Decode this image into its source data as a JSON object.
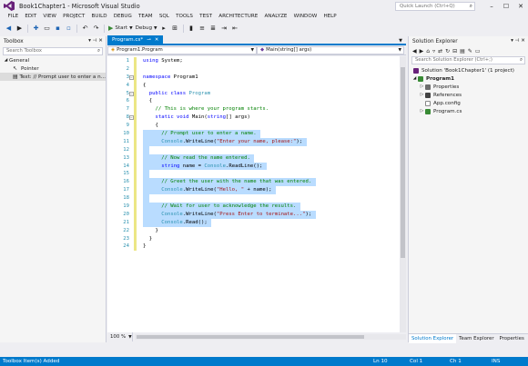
{
  "window": {
    "title": "Book1Chapter1 - Microsoft Visual Studio",
    "quick_launch_placeholder": "Quick Launch (Ctrl+Q)"
  },
  "menu": [
    "FILE",
    "EDIT",
    "VIEW",
    "PROJECT",
    "BUILD",
    "DEBUG",
    "TEAM",
    "SQL",
    "TOOLS",
    "TEST",
    "ARCHITECTURE",
    "ANALYZE",
    "WINDOW",
    "HELP"
  ],
  "toolbar": {
    "start_label": "Start",
    "config_label": "Debug"
  },
  "toolbox": {
    "title": "Toolbox",
    "search_placeholder": "Search Toolbox",
    "group": "General",
    "items": [
      {
        "label": "Pointer"
      },
      {
        "label": "Text: // Prompt user to enter a n..."
      }
    ]
  },
  "editor": {
    "tab_label": "Program.cs*",
    "nav_left": "Program1.Program",
    "nav_right": "Main(string[] args)",
    "zoom": "100 %",
    "code_lines": [
      {
        "n": "1",
        "tokens": [
          {
            "c": "kw",
            "t": "using"
          },
          {
            "c": "pl",
            "t": " System;"
          }
        ]
      },
      {
        "n": "2",
        "tokens": []
      },
      {
        "n": "3",
        "tokens": [
          {
            "c": "kw",
            "t": "namespace"
          },
          {
            "c": "pl",
            "t": " Program1"
          }
        ]
      },
      {
        "n": "4",
        "tokens": [
          {
            "c": "pl",
            "t": "{"
          }
        ]
      },
      {
        "n": "5",
        "tokens": [
          {
            "c": "pl",
            "t": "  "
          },
          {
            "c": "kw",
            "t": "public class"
          },
          {
            "c": "pl",
            "t": " "
          },
          {
            "c": "ty",
            "t": "Program"
          }
        ]
      },
      {
        "n": "6",
        "tokens": [
          {
            "c": "pl",
            "t": "  {"
          }
        ]
      },
      {
        "n": "7",
        "tokens": [
          {
            "c": "cm",
            "t": "    // This is where your program starts."
          }
        ]
      },
      {
        "n": "8",
        "tokens": [
          {
            "c": "pl",
            "t": "    "
          },
          {
            "c": "kw",
            "t": "static void"
          },
          {
            "c": "pl",
            "t": " Main("
          },
          {
            "c": "kw",
            "t": "string"
          },
          {
            "c": "pl",
            "t": "[] args)"
          }
        ]
      },
      {
        "n": "9",
        "tokens": [
          {
            "c": "pl",
            "t": "    {"
          }
        ]
      },
      {
        "n": "10",
        "tokens": [
          {
            "c": "cm",
            "t": "      // Prompt user to enter a name."
          }
        ]
      },
      {
        "n": "11",
        "tokens": [
          {
            "c": "pl",
            "t": "      "
          },
          {
            "c": "ty",
            "t": "Console"
          },
          {
            "c": "pl",
            "t": ".WriteLine("
          },
          {
            "c": "st",
            "t": "\"Enter your name, please:\""
          },
          {
            "c": "pl",
            "t": ");"
          }
        ]
      },
      {
        "n": "12",
        "tokens": []
      },
      {
        "n": "13",
        "tokens": [
          {
            "c": "cm",
            "t": "      // Now read the name entered."
          }
        ]
      },
      {
        "n": "14",
        "tokens": [
          {
            "c": "pl",
            "t": "      "
          },
          {
            "c": "kw",
            "t": "string"
          },
          {
            "c": "pl",
            "t": " name = "
          },
          {
            "c": "ty",
            "t": "Console"
          },
          {
            "c": "pl",
            "t": ".ReadLine();"
          }
        ]
      },
      {
        "n": "15",
        "tokens": []
      },
      {
        "n": "16",
        "tokens": [
          {
            "c": "cm",
            "t": "      // Greet the user with the name that was entered."
          }
        ]
      },
      {
        "n": "17",
        "tokens": [
          {
            "c": "pl",
            "t": "      "
          },
          {
            "c": "ty",
            "t": "Console"
          },
          {
            "c": "pl",
            "t": ".WriteLine("
          },
          {
            "c": "st",
            "t": "\"Hello, \""
          },
          {
            "c": "pl",
            "t": " + name);"
          }
        ]
      },
      {
        "n": "18",
        "tokens": []
      },
      {
        "n": "19",
        "tokens": [
          {
            "c": "cm",
            "t": "      // Wait for user to acknowledge the results."
          }
        ]
      },
      {
        "n": "20",
        "tokens": [
          {
            "c": "pl",
            "t": "      "
          },
          {
            "c": "ty",
            "t": "Console"
          },
          {
            "c": "pl",
            "t": ".WriteLine("
          },
          {
            "c": "st",
            "t": "\"Press Enter to terminate...\""
          },
          {
            "c": "pl",
            "t": ");"
          }
        ]
      },
      {
        "n": "21",
        "tokens": [
          {
            "c": "pl",
            "t": "      "
          },
          {
            "c": "ty",
            "t": "Console"
          },
          {
            "c": "pl",
            "t": ".Read();"
          }
        ]
      },
      {
        "n": "22",
        "tokens": [
          {
            "c": "pl",
            "t": "    }"
          }
        ]
      },
      {
        "n": "23",
        "tokens": [
          {
            "c": "pl",
            "t": "  }"
          }
        ]
      },
      {
        "n": "24",
        "tokens": [
          {
            "c": "pl",
            "t": "}"
          }
        ]
      }
    ],
    "selected_from_line": 10,
    "selected_to_line": 21
  },
  "solution_explorer": {
    "title": "Solution Explorer",
    "search_placeholder": "Search Solution Explorer (Ctrl+;)",
    "solution": "Solution 'Book1Chapter1' (1 project)",
    "project": "Program1",
    "items": [
      "Properties",
      "References",
      "App.config",
      "Program.cs"
    ],
    "tabs": [
      "Solution Explorer",
      "Team Explorer",
      "Properties"
    ]
  },
  "status": {
    "message": "Toolbox Item(s) Added",
    "line": "Ln 10",
    "col": "Col 1",
    "ch": "Ch 1",
    "mode": "INS"
  },
  "colors": {
    "accent": "#007acc",
    "selection": "#add6ff",
    "changed_margin": "#ece685"
  }
}
